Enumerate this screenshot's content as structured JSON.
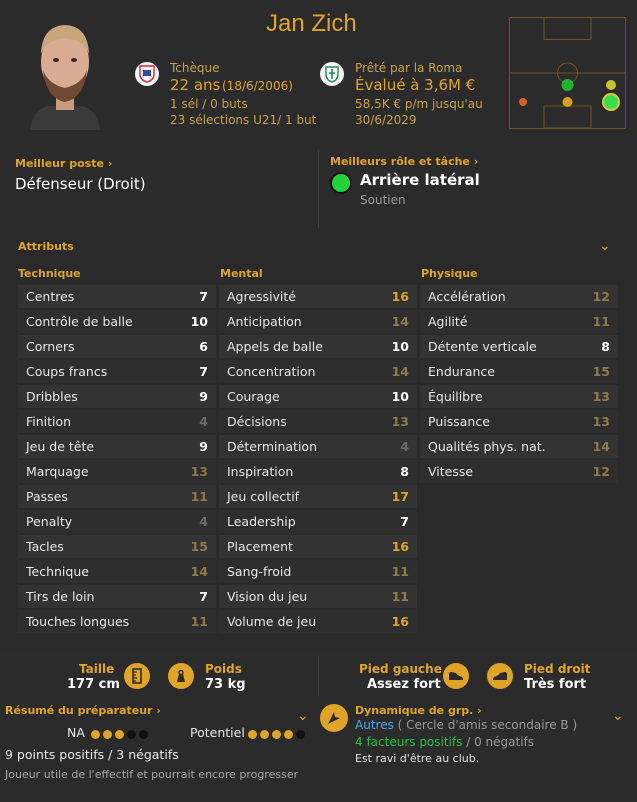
{
  "player": {
    "name": "Jan Zich",
    "nationality": "Tchèque",
    "age_dob": "22 ans",
    "dob": "(18/6/2006)",
    "caps": "1 sél / 0 buts",
    "u21": "23 sélections U21/ 1 but",
    "loan": "Prêté par la Roma",
    "value": "Évalué à 3,6M €",
    "wage": "58,5K € p/m jusqu'au",
    "contract_end": "30/6/2029"
  },
  "best_position": {
    "title": "Meilleur poste",
    "value": "Défenseur (Droit)"
  },
  "best_role": {
    "title": "Meilleurs rôle et tâche",
    "value": "Arrière latéral",
    "duty": "Soutien"
  },
  "attributes": {
    "title": "Attributs",
    "technique_title": "Technique",
    "mental_title": "Mental",
    "physique_title": "Physique",
    "technique": [
      {
        "name": "Centres",
        "value": "7"
      },
      {
        "name": "Contrôle de balle",
        "value": "10"
      },
      {
        "name": "Corners",
        "value": "6"
      },
      {
        "name": "Coups francs",
        "value": "7"
      },
      {
        "name": "Dribbles",
        "value": "9"
      },
      {
        "name": "Finition",
        "value": "4"
      },
      {
        "name": "Jeu de tête",
        "value": "9"
      },
      {
        "name": "Marquage",
        "value": "13"
      },
      {
        "name": "Passes",
        "value": "11"
      },
      {
        "name": "Penalty",
        "value": "4"
      },
      {
        "name": "Tacles",
        "value": "15"
      },
      {
        "name": "Technique",
        "value": "14"
      },
      {
        "name": "Tirs de loin",
        "value": "7"
      },
      {
        "name": "Touches longues",
        "value": "11"
      }
    ],
    "mental": [
      {
        "name": "Agressivité",
        "value": "16"
      },
      {
        "name": "Anticipation",
        "value": "14"
      },
      {
        "name": "Appels de balle",
        "value": "10"
      },
      {
        "name": "Concentration",
        "value": "14"
      },
      {
        "name": "Courage",
        "value": "10"
      },
      {
        "name": "Décisions",
        "value": "13"
      },
      {
        "name": "Détermination",
        "value": "4"
      },
      {
        "name": "Inspiration",
        "value": "8"
      },
      {
        "name": "Jeu collectif",
        "value": "17"
      },
      {
        "name": "Leadership",
        "value": "7"
      },
      {
        "name": "Placement",
        "value": "16"
      },
      {
        "name": "Sang-froid",
        "value": "11"
      },
      {
        "name": "Vision du jeu",
        "value": "11"
      },
      {
        "name": "Volume de jeu",
        "value": "16"
      }
    ],
    "physique": [
      {
        "name": "Accélération",
        "value": "12"
      },
      {
        "name": "Agilité",
        "value": "11"
      },
      {
        "name": "Détente verticale",
        "value": "8"
      },
      {
        "name": "Endurance",
        "value": "15"
      },
      {
        "name": "Équilibre",
        "value": "13"
      },
      {
        "name": "Puissance",
        "value": "13"
      },
      {
        "name": "Qualités phys. nat.",
        "value": "14"
      },
      {
        "name": "Vitesse",
        "value": "12"
      }
    ]
  },
  "physical": {
    "height_label": "Taille",
    "height": "177 cm",
    "weight_label": "Poids",
    "weight": "73 kg",
    "left_foot_label": "Pied gauche",
    "left_foot": "Assez fort",
    "right_foot_label": "Pied droit",
    "right_foot": "Très fort"
  },
  "coach_report": {
    "title": "Résumé du préparateur",
    "na_label": "NA",
    "na_stars": 3,
    "potential_label": "Potentiel",
    "potential_stars": 4,
    "summary": "9 points positifs / 3 négatifs",
    "note": "Joueur utile de l'effectif et pourrait encore progresser"
  },
  "group_dynamics": {
    "title": "Dynamique de grp.",
    "group": "Autres",
    "group_detail": "( Cercle d'amis secondaire B )",
    "positives": "4 facteurs positifs",
    "negatives": "/ 0 négatifs",
    "mood": "Est ravi d'être au club."
  },
  "colors": {
    "accent": "#e0a526",
    "background": "#2b2b2b",
    "green": "#22c33a",
    "blue_link": "#4aa8e8"
  },
  "icons": [
    "chevron-right-icon",
    "chevron-down-icon",
    "ruler-icon",
    "weight-icon",
    "boot-icon",
    "compass-icon"
  ]
}
